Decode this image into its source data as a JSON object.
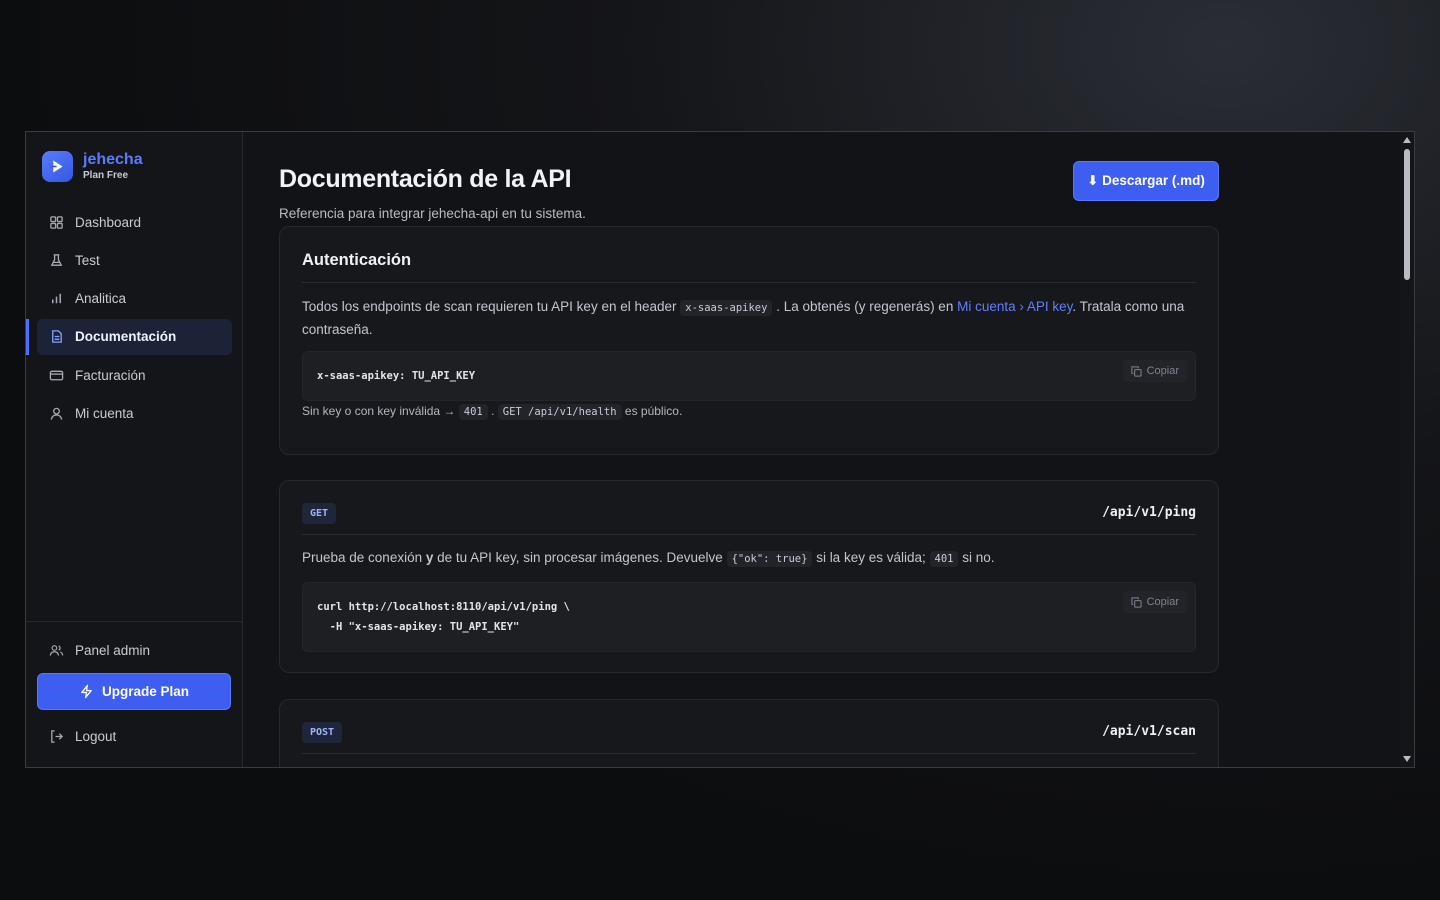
{
  "brand": {
    "name": "jehecha",
    "plan": "Plan Free"
  },
  "nav": [
    {
      "label": "Dashboard",
      "icon": "grid-icon"
    },
    {
      "label": "Test",
      "icon": "flask-icon"
    },
    {
      "label": "Analitica",
      "icon": "bar-chart-icon"
    },
    {
      "label": "Documentación",
      "icon": "document-icon",
      "active": true
    },
    {
      "label": "Facturación",
      "icon": "credit-card-icon"
    },
    {
      "label": "Mi cuenta",
      "icon": "user-icon"
    }
  ],
  "sidebar_bottom": {
    "admin_label": "Panel admin",
    "upgrade_label": "Upgrade Plan",
    "logout_label": "Logout"
  },
  "header": {
    "title": "Documentación de la API",
    "subtitle": "Referencia para integrar jehecha-api en tu sistema.",
    "download_label": "⬇ Descargar (.md)"
  },
  "auth": {
    "title": "Autenticación",
    "p1": "Todos los endpoints de scan requieren tu API key en el header",
    "header_code": "x-saas-apikey",
    "p2": ". La obtenés (y regenerás) en",
    "link": "Mi cuenta › API key",
    "p3": ". Tratala como una contraseña.",
    "code": "x-saas-apikey: TU_API_KEY",
    "copy_label": "Copiar",
    "note1": "Sin key o con key inválida →",
    "note_code1": "401",
    "note2": ".",
    "note_code2": "GET /api/v1/health",
    "note3": "es público."
  },
  "ping": {
    "method": "GET",
    "path": "/api/v1/ping",
    "d1": "Prueba de conexión",
    "d_bold": "y",
    "d2": "de tu API key, sin procesar imágenes. Devuelve",
    "d_code1": "{\"ok\": true}",
    "d3": "si la key es válida;",
    "d_code2": "401",
    "d4": "si no.",
    "code": "curl http://localhost:8110/api/v1/ping \\\n  -H \"x-saas-apikey: TU_API_KEY\"",
    "copy_label": "Copiar"
  },
  "scan": {
    "method": "POST",
    "path": "/api/v1/scan"
  },
  "colors": {
    "accent": "#3d5ef0",
    "link": "#5f7fff",
    "background": "#121316"
  }
}
